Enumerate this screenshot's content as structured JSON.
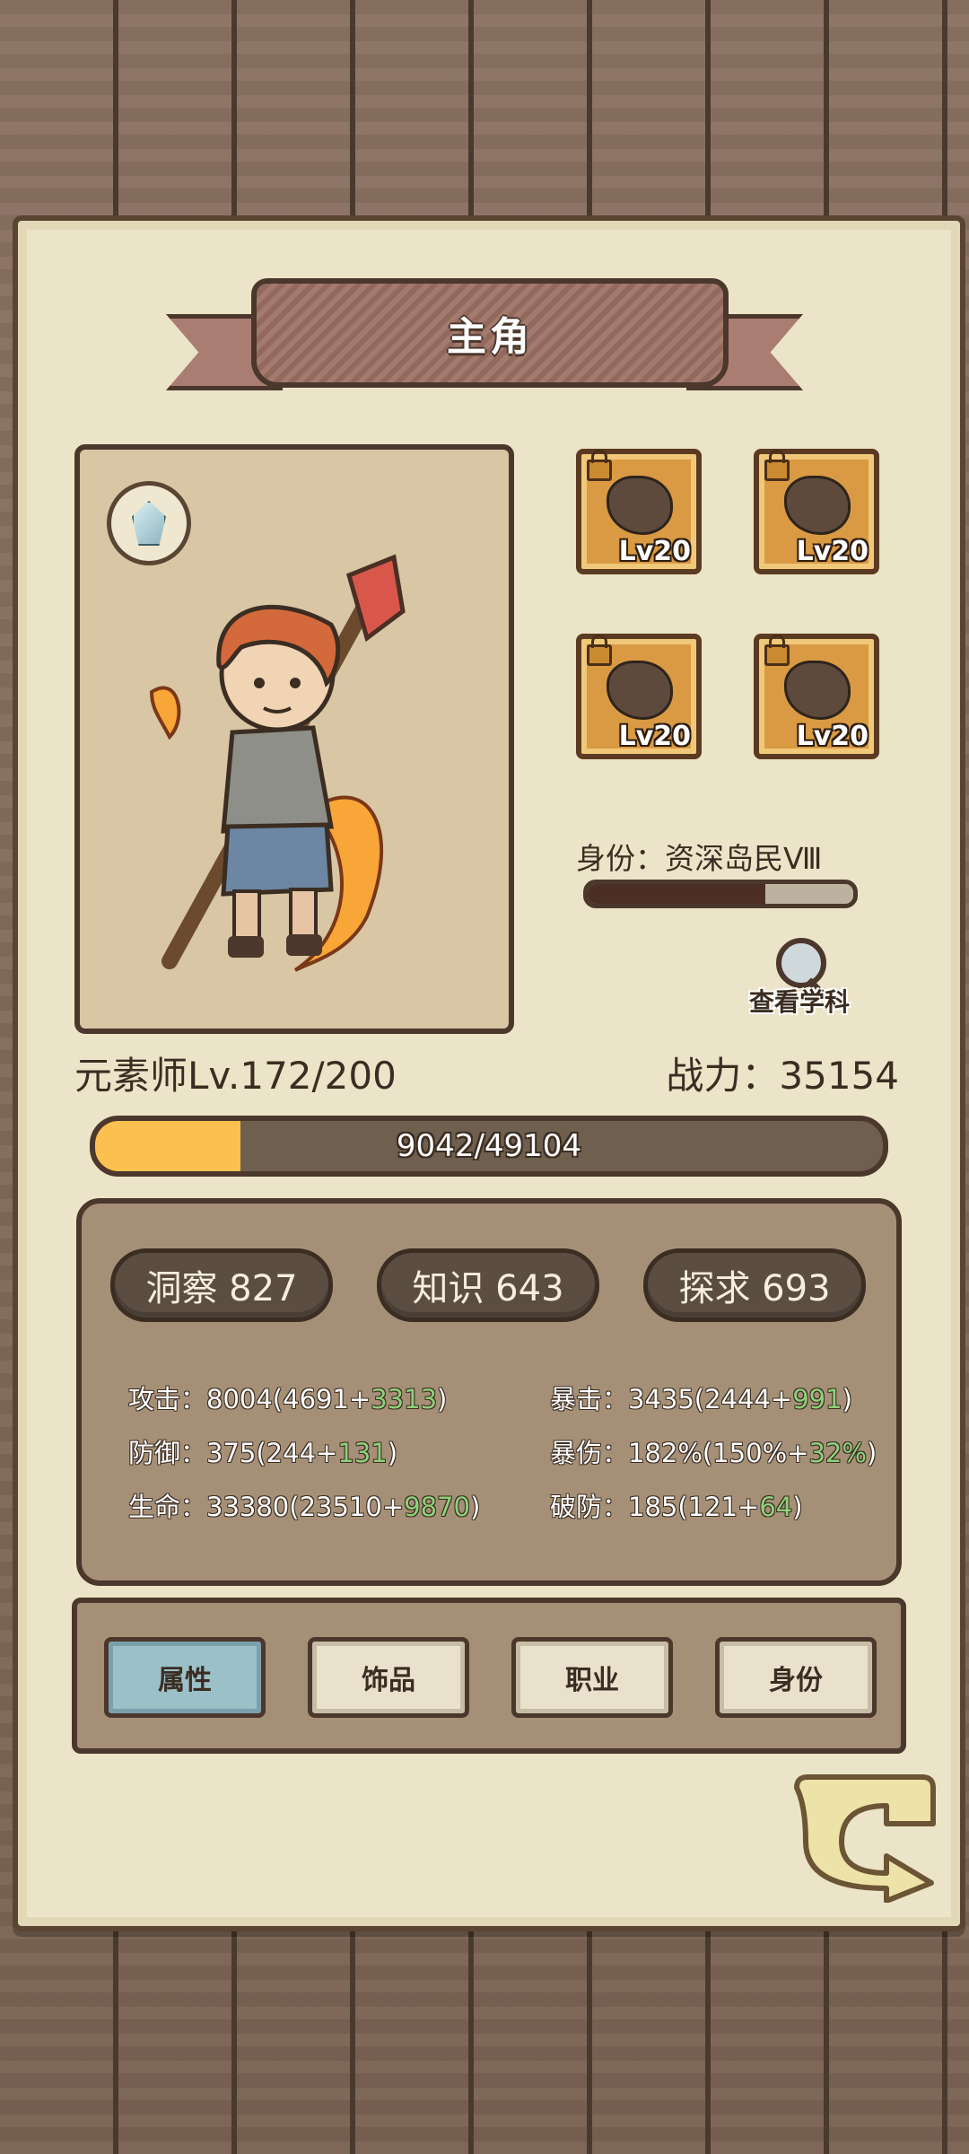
{
  "title": "主角",
  "character": {
    "class_level": "元素师Lv.172/200",
    "power": "战力：35154",
    "xp_text": "9042/49104",
    "xp_progress": 0.184
  },
  "equipment": [
    {
      "level": "Lv20",
      "icon": "ore-chunk-icon"
    },
    {
      "level": "Lv20",
      "icon": "ore-earrings-icon"
    },
    {
      "level": "Lv20",
      "icon": "ore-necklace-icon"
    },
    {
      "level": "Lv20",
      "icon": "ore-gauntlet-icon"
    }
  ],
  "identity": {
    "label": "身份：资深岛民Ⅷ",
    "progress": 0.67
  },
  "discipline_label": "查看学科",
  "attributes": [
    {
      "label": "洞察 827"
    },
    {
      "label": "知识 643"
    },
    {
      "label": "探求 693"
    }
  ],
  "stats_left": [
    {
      "base": "攻击：8004(4691+",
      "bonus": "3313",
      "end": ")"
    },
    {
      "base": "防御：375(244+",
      "bonus": "131",
      "end": ")"
    },
    {
      "base": "生命：33380(23510+",
      "bonus": "9870",
      "end": ")"
    }
  ],
  "stats_right": [
    {
      "base": "暴击：3435(2444+",
      "bonus": "991",
      "end": ")"
    },
    {
      "base": "暴伤：182%(150%+",
      "bonus": "32%",
      "end": ")"
    },
    {
      "base": "破防：185(121+",
      "bonus": "64",
      "end": ")"
    }
  ],
  "tabs": [
    "属性",
    "饰品",
    "职业",
    "身份"
  ],
  "colors": {
    "xp_fill": "#fbc150",
    "bonus": "#8ed07b",
    "active_tab": "#9bc0c8",
    "panel": "#ece4c8"
  }
}
